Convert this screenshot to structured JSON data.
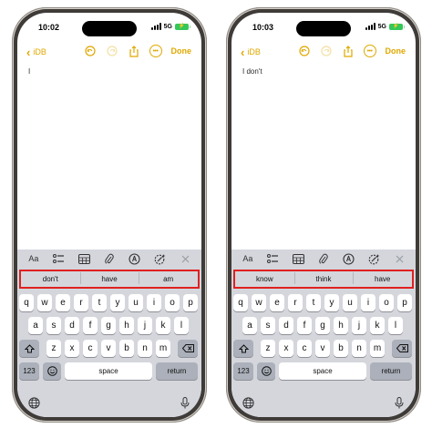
{
  "screens": [
    {
      "status": {
        "time": "10:02",
        "network": "5G",
        "battery": "⚡"
      },
      "nav": {
        "back_label": "iDB",
        "done_label": "Done"
      },
      "note_text": "I",
      "suggestions": [
        "don't",
        "have",
        "am"
      ]
    },
    {
      "status": {
        "time": "10:03",
        "network": "5G",
        "battery": "⚡"
      },
      "nav": {
        "back_label": "iDB",
        "done_label": "Done"
      },
      "note_text": "I don't",
      "suggestions": [
        "know",
        "think",
        "have"
      ]
    }
  ],
  "toolbar": {
    "format_label": "Aa"
  },
  "keyboard": {
    "row1": [
      "q",
      "w",
      "e",
      "r",
      "t",
      "y",
      "u",
      "i",
      "o",
      "p"
    ],
    "row2": [
      "a",
      "s",
      "d",
      "f",
      "g",
      "h",
      "j",
      "k",
      "l"
    ],
    "row3": [
      "z",
      "x",
      "c",
      "v",
      "b",
      "n",
      "m"
    ],
    "numbers_label": "123",
    "space_label": "space",
    "return_label": "return"
  },
  "colors": {
    "accent": "#e0a800",
    "highlight": "#e02020",
    "keyboard_bg": "#d4d6dc"
  }
}
